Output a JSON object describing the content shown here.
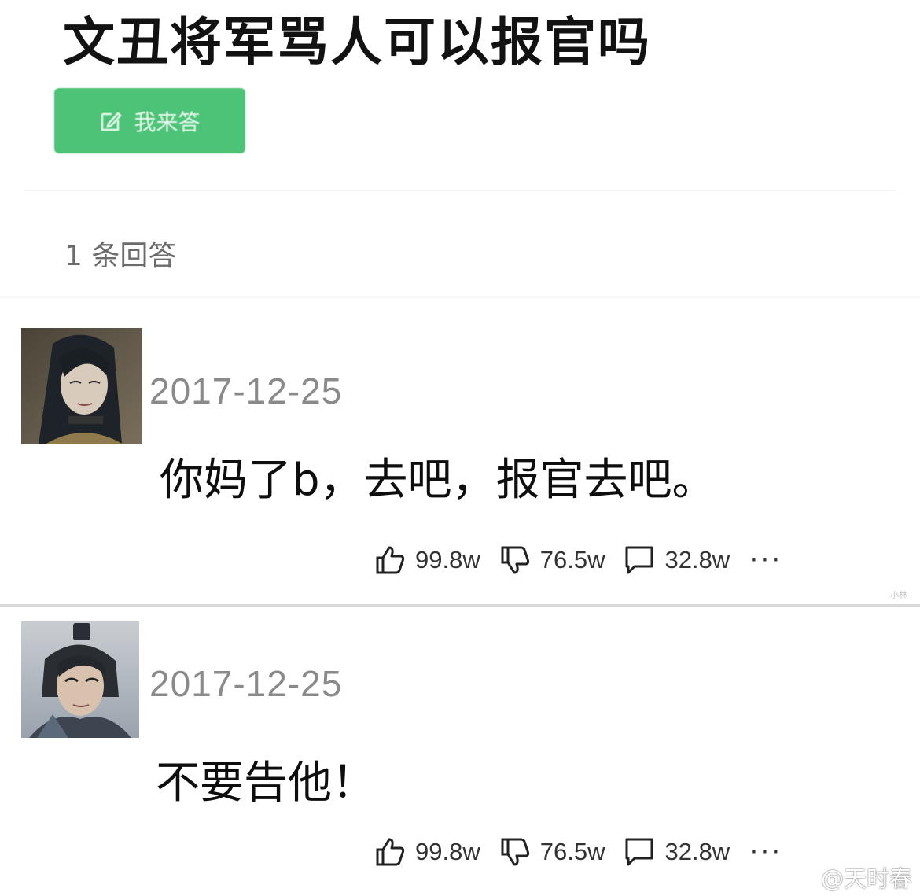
{
  "question": {
    "title": "文丑将军骂人可以报官吗",
    "answer_button_label": "我来答",
    "answer_count_label": "1 条回答"
  },
  "answers": [
    {
      "date": "2017-12-25",
      "text": "你妈了b，去吧，报官去吧。",
      "likes": "99.8w",
      "dislikes": "76.5w",
      "comments": "32.8w",
      "more": "···"
    },
    {
      "date": "2017-12-25",
      "text": "不要告他！",
      "likes": "99.8w",
      "dislikes": "76.5w",
      "comments": "32.8w",
      "more": "···"
    }
  ],
  "watermark": {
    "corner_text": "小林",
    "weibo_handle": "@天时春"
  },
  "colors": {
    "accent_green": "#4cc377",
    "date_gray": "#8a8a8a"
  },
  "icons": [
    "edit-icon",
    "thumbs-up-icon",
    "thumbs-down-icon",
    "comment-icon",
    "weibo-logo-icon"
  ]
}
